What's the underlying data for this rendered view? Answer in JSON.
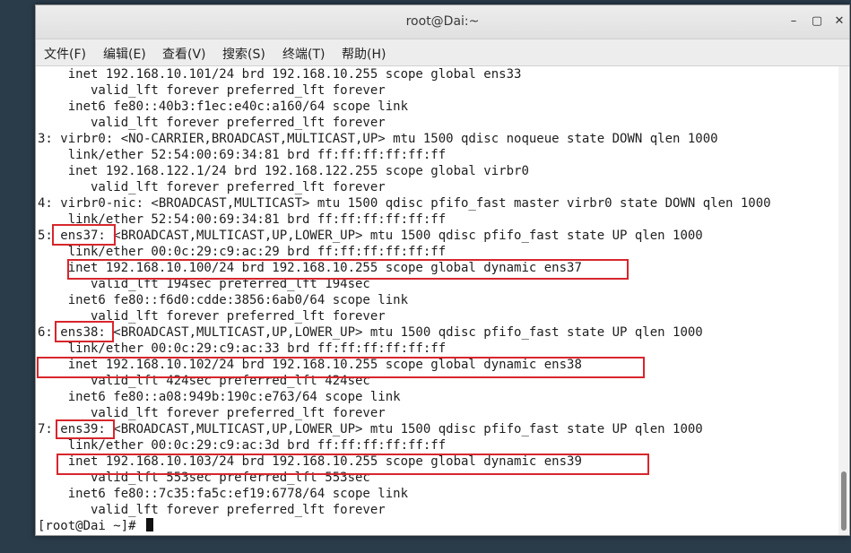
{
  "window": {
    "title": "root@Dai:~",
    "controls": {
      "minimize": "–",
      "maximize": "▢",
      "close": "✕"
    }
  },
  "menu": [
    {
      "label": "文件(F)"
    },
    {
      "label": "编辑(E)"
    },
    {
      "label": "查看(V)"
    },
    {
      "label": "搜索(S)"
    },
    {
      "label": "终端(T)"
    },
    {
      "label": "帮助(H)"
    }
  ],
  "terminal": {
    "lines": [
      "    inet 192.168.10.101/24 brd 192.168.10.255 scope global ens33",
      "       valid_lft forever preferred_lft forever",
      "    inet6 fe80::40b3:f1ec:e40c:a160/64 scope link",
      "       valid_lft forever preferred_lft forever",
      "3: virbr0: <NO-CARRIER,BROADCAST,MULTICAST,UP> mtu 1500 qdisc noqueue state DOWN qlen 1000",
      "    link/ether 52:54:00:69:34:81 brd ff:ff:ff:ff:ff:ff",
      "    inet 192.168.122.1/24 brd 192.168.122.255 scope global virbr0",
      "       valid_lft forever preferred_lft forever",
      "4: virbr0-nic: <BROADCAST,MULTICAST> mtu 1500 qdisc pfifo_fast master virbr0 state DOWN qlen 1000",
      "    link/ether 52:54:00:69:34:81 brd ff:ff:ff:ff:ff:ff",
      "5: ens37: <BROADCAST,MULTICAST,UP,LOWER_UP> mtu 1500 qdisc pfifo_fast state UP qlen 1000",
      "    link/ether 00:0c:29:c9:ac:29 brd ff:ff:ff:ff:ff:ff",
      "    inet 192.168.10.100/24 brd 192.168.10.255 scope global dynamic ens37",
      "       valid_lft 194sec preferred_lft 194sec",
      "    inet6 fe80::f6d0:cdde:3856:6ab0/64 scope link",
      "       valid_lft forever preferred_lft forever",
      "6: ens38: <BROADCAST,MULTICAST,UP,LOWER_UP> mtu 1500 qdisc pfifo_fast state UP qlen 1000",
      "    link/ether 00:0c:29:c9:ac:33 brd ff:ff:ff:ff:ff:ff",
      "    inet 192.168.10.102/24 brd 192.168.10.255 scope global dynamic ens38",
      "       valid_lft 424sec preferred_lft 424sec",
      "    inet6 fe80::a08:949b:190c:e763/64 scope link",
      "       valid_lft forever preferred_lft forever",
      "7: ens39: <BROADCAST,MULTICAST,UP,LOWER_UP> mtu 1500 qdisc pfifo_fast state UP qlen 1000",
      "    link/ether 00:0c:29:c9:ac:3d brd ff:ff:ff:ff:ff:ff",
      "    inet 192.168.10.103/24 brd 192.168.10.255 scope global dynamic ens39",
      "       valid_lft 553sec preferred_lft 553sec",
      "    inet6 fe80::7c35:fa5c:ef19:6778/64 scope link",
      "       valid_lft forever preferred_lft forever"
    ],
    "prompt": "[root@Dai ~]# "
  },
  "colors": {
    "highlight": "#d7262c",
    "background": "#2a3b4a",
    "terminal_bg": "#ffffff",
    "terminal_fg": "#1e1e1e"
  }
}
